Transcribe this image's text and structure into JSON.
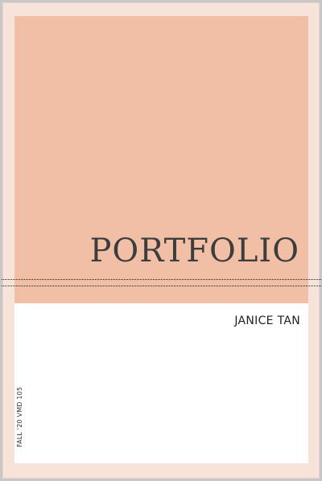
{
  "document": {
    "title": "PORTFOLIO",
    "author": "JANICE TAN",
    "course": "FALL '20 VMD 105"
  },
  "colors": {
    "background": "#c7c7c7",
    "page_border": "#f7e3da",
    "accent_block": "#f0bfa6",
    "title_text": "#3d3d3d"
  }
}
